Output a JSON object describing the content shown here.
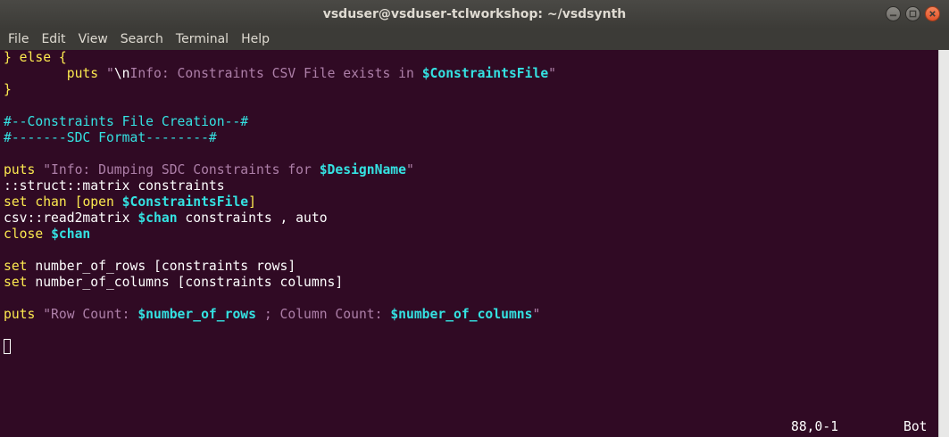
{
  "window": {
    "title": "vsduser@vsduser-tclworkshop: ~/vsdsynth"
  },
  "menu": [
    "File",
    "Edit",
    "View",
    "Search",
    "Terminal",
    "Help"
  ],
  "editor": {
    "l1": [
      "} else {"
    ],
    "l2": [
      "        ",
      "puts",
      " \"",
      "\\n",
      "Info: Constraints CSV File exists in ",
      "$ConstraintsFile",
      "\""
    ],
    "l3": [
      "}"
    ],
    "l5": [
      "#--Constraints File Creation--#"
    ],
    "l6": [
      "#-------SDC Format--------#"
    ],
    "l8": [
      "puts",
      " \"Info: Dumping SDC Constraints for ",
      "$DesignName",
      "\""
    ],
    "l9": [
      "::struct::matrix constraints"
    ],
    "l10": [
      "set chan [",
      "open",
      " ",
      "$ConstraintsFile",
      "]"
    ],
    "l11": [
      "csv::read2matrix ",
      "$chan",
      " constraints , auto"
    ],
    "l12": [
      "close",
      " ",
      "$chan"
    ],
    "l14": [
      "set",
      " number_of_rows [constraints rows]"
    ],
    "l15": [
      "set",
      " number_of_columns [constraints columns]"
    ],
    "l17": [
      "puts",
      " \"Row Count: ",
      "$number_of_rows",
      " ; Column Count: ",
      "$number_of_columns",
      "\""
    ]
  },
  "status": {
    "position": "88,0-1",
    "scroll": "Bot"
  }
}
